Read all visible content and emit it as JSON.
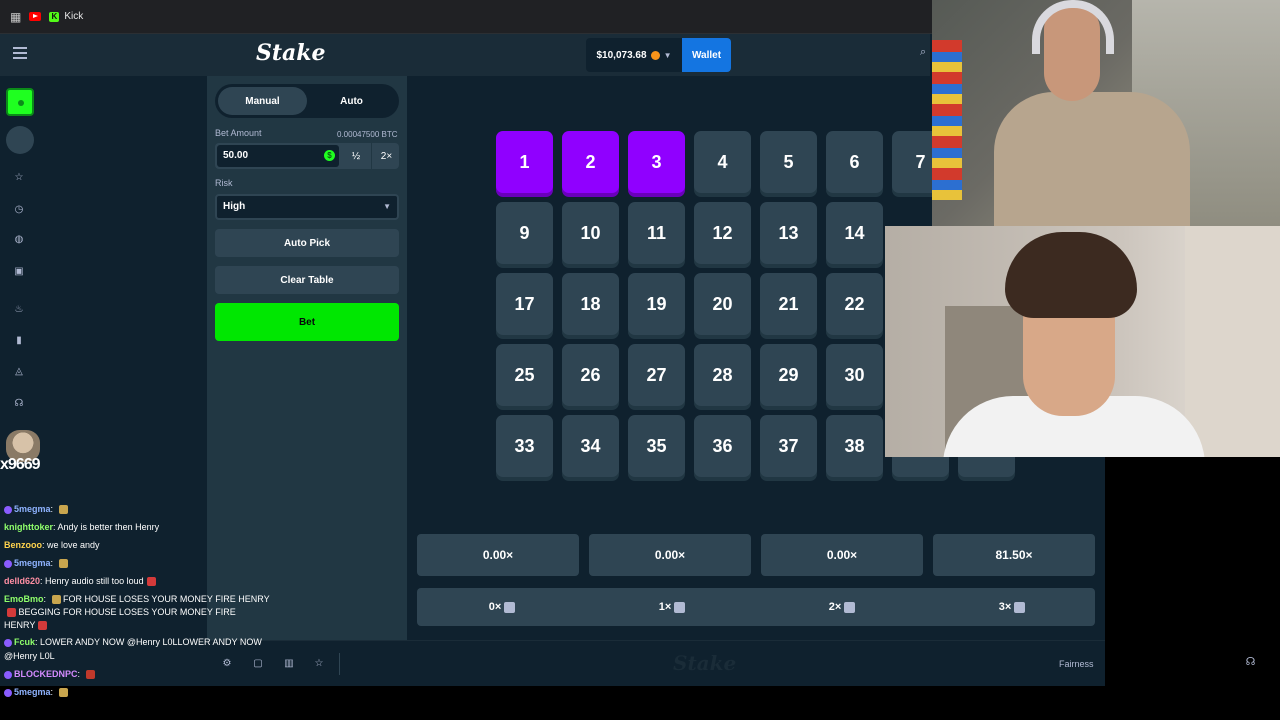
{
  "browser": {
    "tab_label": "Kick"
  },
  "header": {
    "logo": "Stake",
    "balance": "$10,073.68",
    "wallet_label": "Wallet"
  },
  "bet_panel": {
    "modes": [
      "Manual",
      "Auto"
    ],
    "active_mode": "Manual",
    "bet_amount_label": "Bet Amount",
    "bet_amount_btc": "0.00047500 BTC",
    "bet_amount_value": "50.00",
    "half_label": "½",
    "double_label": "2×",
    "risk_label": "Risk",
    "risk_value": "High",
    "auto_pick_label": "Auto Pick",
    "clear_table_label": "Clear Table",
    "bet_label": "Bet"
  },
  "grid": {
    "rows": [
      [
        "1",
        "2",
        "3",
        "4",
        "5",
        "6",
        "7"
      ],
      [
        "9",
        "10",
        "11",
        "12",
        "13",
        "14"
      ],
      [
        "17",
        "18",
        "19",
        "20",
        "21",
        "22"
      ],
      [
        "25",
        "26",
        "27",
        "28",
        "29",
        "30"
      ],
      [
        "33",
        "34",
        "35",
        "36",
        "37",
        "38"
      ]
    ],
    "selected": [
      "1",
      "2",
      "3"
    ]
  },
  "multipliers": [
    "0.00×",
    "0.00×",
    "0.00×",
    "81.50×"
  ],
  "hits": [
    "0×",
    "1×",
    "2×",
    "3×"
  ],
  "footer": {
    "fairness_label": "Fairness"
  },
  "chat": {
    "streamer_name": "x9669",
    "messages": [
      {
        "user": "5megma",
        "text": "",
        "color": "#8fb3ff"
      },
      {
        "user": "knighttoker",
        "text": "Andy is better then Henry",
        "color": "#8fff6b"
      },
      {
        "user": "Benzooo",
        "text": "we love andy",
        "color": "#ffd34d"
      },
      {
        "user": "5megma",
        "text": "",
        "color": "#8fb3ff"
      },
      {
        "user": "delld620",
        "text": "Henry audio still too loud",
        "color": "#ff8fa3"
      },
      {
        "user": "EmoBmo",
        "text": "FOR HOUSE LOSES YOUR MONEY FIRE HENRY",
        "color": "#8fff6b"
      },
      {
        "user": "",
        "text": "BEGGING FOR HOUSE LOSES YOUR MONEY FIRE",
        "color": "#ffffff"
      },
      {
        "user": "",
        "text": "HENRY",
        "color": "#ffffff"
      },
      {
        "user": "Fcuk",
        "text": "LOWER ANDY NOW @Henry L0LLOWER ANDY NOW",
        "color": "#8fff6b"
      },
      {
        "user": "",
        "text": "@Henry L0L",
        "color": "#ffffff"
      },
      {
        "user": "BLOCKEDNPC",
        "text": "",
        "color": "#d48bff"
      },
      {
        "user": "5megma",
        "text": "",
        "color": "#8fb3ff"
      }
    ]
  }
}
